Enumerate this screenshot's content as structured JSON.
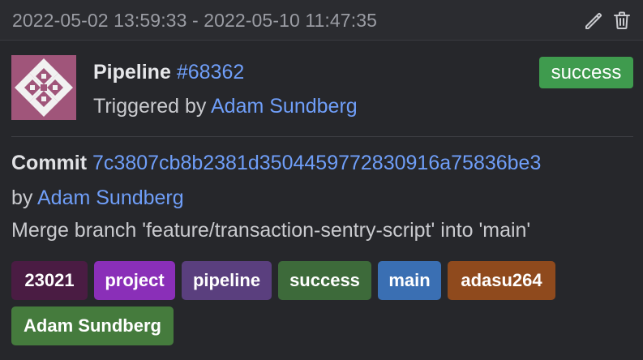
{
  "header": {
    "time_range": "2022-05-02 13:59:33 - 2022-05-10 11:47:35",
    "edit_icon": "pencil-icon",
    "delete_icon": "trash-icon"
  },
  "pipeline": {
    "label": "Pipeline",
    "id": "#68362",
    "triggered_prefix": "Triggered by",
    "triggered_by": "Adam Sundberg",
    "status": "success",
    "status_color": "#3f9b4e"
  },
  "commit": {
    "label": "Commit",
    "sha": "7c3807cb8b2381d3504459772830916a75836be3",
    "by_prefix": "by",
    "author": "Adam Sundberg",
    "message": "Merge branch 'feature/transaction-sentry-script' into 'main'"
  },
  "tags": [
    {
      "label": "23021",
      "color": "#4a1c43"
    },
    {
      "label": "project",
      "color": "#8a2fb8"
    },
    {
      "label": "pipeline",
      "color": "#5a3f7e"
    },
    {
      "label": "success",
      "color": "#3d6a3a"
    },
    {
      "label": "main",
      "color": "#3a6fb3"
    },
    {
      "label": "adasu264",
      "color": "#8f4a1d"
    },
    {
      "label": "Adam Sundberg",
      "color": "#457b3d"
    }
  ],
  "colors": {
    "background": "#26272b",
    "link": "#6f9ef8",
    "avatar": "#a0557a"
  }
}
